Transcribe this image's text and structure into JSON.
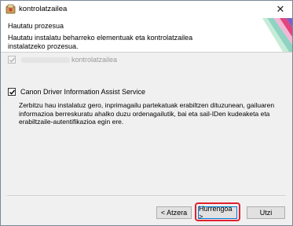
{
  "window": {
    "title": "kontrolatzailea",
    "icon": "installer-app-icon",
    "close_symbol": "✕"
  },
  "header": {
    "title": "Hautatu prozesua",
    "subtitle_line1": "Hautatu instalatu beharreko elementuak eta kontrolatzailea",
    "subtitle_line2": "instalatzeko prozesua."
  },
  "options": [
    {
      "label": "kontrolatzailea",
      "checked": true,
      "disabled": true
    },
    {
      "label": "Canon Driver Information Assist Service",
      "checked": true,
      "disabled": false,
      "description": "Zerbitzu hau instalatuz gero, inprimagailu partekatuak erabiltzen dituzunean, gailuaren informazioa berreskuratu ahalko duzu ordenagailutik, bai eta sail-IDen kudeaketa eta erabiltzaile-autentifikazioa egin ere."
    }
  ],
  "buttons": {
    "back": "< Atzera",
    "next": "Hurrengoa >",
    "cancel": "Utzi"
  },
  "colors": {
    "highlight": "#e0202f",
    "focus_border": "#0078d7"
  }
}
